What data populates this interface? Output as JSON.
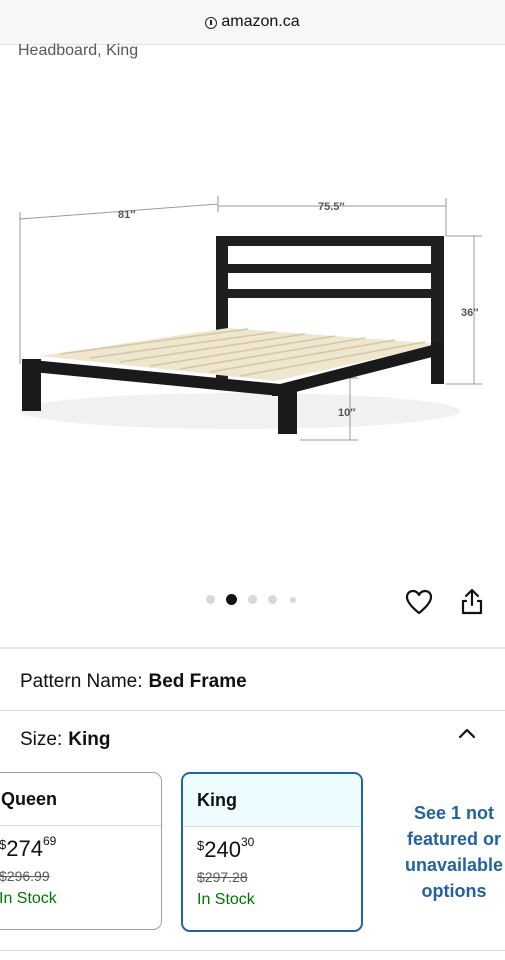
{
  "browser": {
    "url": "amazon.ca"
  },
  "product": {
    "title_fragment": "Headboard, King"
  },
  "gallery": {
    "dimensions": {
      "length": "81″",
      "width": "75.5″",
      "headboard_height": "36″",
      "clearance": "10″"
    },
    "image_count": 5,
    "active_index": 1
  },
  "pattern": {
    "label": "Pattern Name:",
    "value": "Bed Frame"
  },
  "size": {
    "label": "Size:",
    "value": "King"
  },
  "options": [
    {
      "name": "Queen",
      "currency": "$",
      "price_whole": "274",
      "price_fraction": "69",
      "list_price": "$296.99",
      "stock": "In Stock",
      "selected": false
    },
    {
      "name": "King",
      "currency": "$",
      "price_whole": "240",
      "price_fraction": "30",
      "list_price": "$297.28",
      "stock": "In Stock",
      "selected": true
    }
  ],
  "more_options": "See 1 not featured or unavailable options",
  "colors": {
    "link": "#2162a1",
    "stock": "#007600",
    "selected_bg": "#edfdff"
  },
  "icons": [
    "info-icon",
    "heart-icon",
    "share-icon",
    "chevron-up-icon"
  ]
}
